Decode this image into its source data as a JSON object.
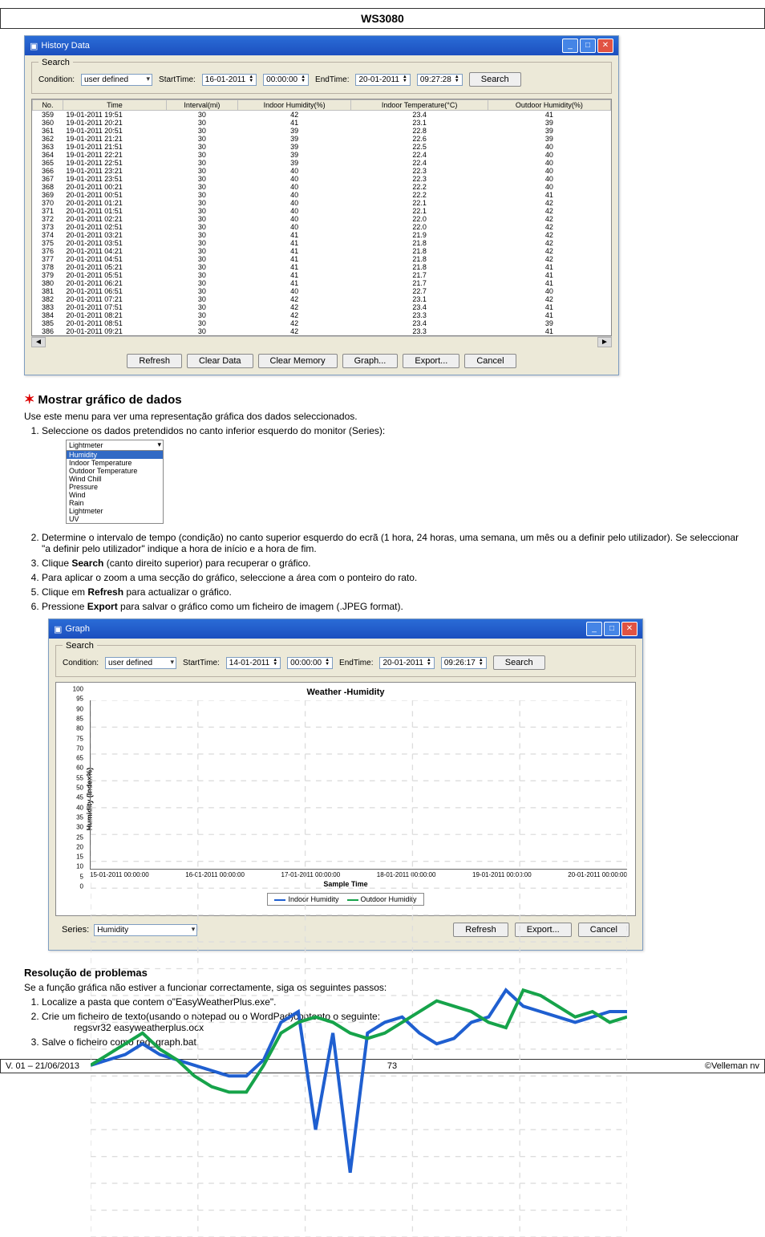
{
  "header": {
    "title": "WS3080"
  },
  "history_window": {
    "title": "History Data",
    "search": {
      "legend": "Search",
      "condition_label": "Condition:",
      "condition_value": "user defined",
      "start_label": "StartTime:",
      "start_date": "16-01-2011",
      "start_time": "00:00:00",
      "end_label": "EndTime:",
      "end_date": "20-01-2011",
      "end_time": "09:27:28",
      "search_btn": "Search"
    },
    "columns": [
      "No.",
      "Time",
      "Interval(mi)",
      "Indoor Humidity(%)",
      "Indoor Temperature(°C)",
      "Outdoor Humidity(%)"
    ],
    "rows": [
      {
        "no": "359",
        "time": "19-01-2011 19:51",
        "interval": "30",
        "ih": "42",
        "it": "23.4",
        "oh": "41"
      },
      {
        "no": "360",
        "time": "19-01-2011 20:21",
        "interval": "30",
        "ih": "41",
        "it": "23.1",
        "oh": "39"
      },
      {
        "no": "361",
        "time": "19-01-2011 20:51",
        "interval": "30",
        "ih": "39",
        "it": "22.8",
        "oh": "39"
      },
      {
        "no": "362",
        "time": "19-01-2011 21:21",
        "interval": "30",
        "ih": "39",
        "it": "22.6",
        "oh": "39"
      },
      {
        "no": "363",
        "time": "19-01-2011 21:51",
        "interval": "30",
        "ih": "39",
        "it": "22.5",
        "oh": "40"
      },
      {
        "no": "364",
        "time": "19-01-2011 22:21",
        "interval": "30",
        "ih": "39",
        "it": "22.4",
        "oh": "40"
      },
      {
        "no": "365",
        "time": "19-01-2011 22:51",
        "interval": "30",
        "ih": "39",
        "it": "22.4",
        "oh": "40"
      },
      {
        "no": "366",
        "time": "19-01-2011 23:21",
        "interval": "30",
        "ih": "40",
        "it": "22.3",
        "oh": "40"
      },
      {
        "no": "367",
        "time": "19-01-2011 23:51",
        "interval": "30",
        "ih": "40",
        "it": "22.3",
        "oh": "40"
      },
      {
        "no": "368",
        "time": "20-01-2011 00:21",
        "interval": "30",
        "ih": "40",
        "it": "22.2",
        "oh": "40"
      },
      {
        "no": "369",
        "time": "20-01-2011 00:51",
        "interval": "30",
        "ih": "40",
        "it": "22.2",
        "oh": "41"
      },
      {
        "no": "370",
        "time": "20-01-2011 01:21",
        "interval": "30",
        "ih": "40",
        "it": "22.1",
        "oh": "42"
      },
      {
        "no": "371",
        "time": "20-01-2011 01:51",
        "interval": "30",
        "ih": "40",
        "it": "22.1",
        "oh": "42"
      },
      {
        "no": "372",
        "time": "20-01-2011 02:21",
        "interval": "30",
        "ih": "40",
        "it": "22.0",
        "oh": "42"
      },
      {
        "no": "373",
        "time": "20-01-2011 02:51",
        "interval": "30",
        "ih": "40",
        "it": "22.0",
        "oh": "42"
      },
      {
        "no": "374",
        "time": "20-01-2011 03:21",
        "interval": "30",
        "ih": "41",
        "it": "21.9",
        "oh": "42"
      },
      {
        "no": "375",
        "time": "20-01-2011 03:51",
        "interval": "30",
        "ih": "41",
        "it": "21.8",
        "oh": "42"
      },
      {
        "no": "376",
        "time": "20-01-2011 04:21",
        "interval": "30",
        "ih": "41",
        "it": "21.8",
        "oh": "42"
      },
      {
        "no": "377",
        "time": "20-01-2011 04:51",
        "interval": "30",
        "ih": "41",
        "it": "21.8",
        "oh": "42"
      },
      {
        "no": "378",
        "time": "20-01-2011 05:21",
        "interval": "30",
        "ih": "41",
        "it": "21.8",
        "oh": "41"
      },
      {
        "no": "379",
        "time": "20-01-2011 05:51",
        "interval": "30",
        "ih": "41",
        "it": "21.7",
        "oh": "41"
      },
      {
        "no": "380",
        "time": "20-01-2011 06:21",
        "interval": "30",
        "ih": "41",
        "it": "21.7",
        "oh": "41"
      },
      {
        "no": "381",
        "time": "20-01-2011 06:51",
        "interval": "30",
        "ih": "40",
        "it": "22.7",
        "oh": "40"
      },
      {
        "no": "382",
        "time": "20-01-2011 07:21",
        "interval": "30",
        "ih": "42",
        "it": "23.1",
        "oh": "42"
      },
      {
        "no": "383",
        "time": "20-01-2011 07:51",
        "interval": "30",
        "ih": "42",
        "it": "23.4",
        "oh": "41"
      },
      {
        "no": "384",
        "time": "20-01-2011 08:21",
        "interval": "30",
        "ih": "42",
        "it": "23.3",
        "oh": "41"
      },
      {
        "no": "385",
        "time": "20-01-2011 08:51",
        "interval": "30",
        "ih": "42",
        "it": "23.4",
        "oh": "39"
      },
      {
        "no": "386",
        "time": "20-01-2011 09:21",
        "interval": "30",
        "ih": "42",
        "it": "23.3",
        "oh": "41"
      }
    ],
    "buttons": {
      "refresh": "Refresh",
      "clear_data": "Clear Data",
      "clear_memory": "Clear Memory",
      "graph": "Graph...",
      "export": "Export...",
      "cancel": "Cancel"
    }
  },
  "section1": {
    "heading": "Mostrar gráfico de dados",
    "intro": "Use este menu para ver uma representação gráfica dos dados seleccionados.",
    "steps": {
      "s1": "Seleccione os dados pretendidos no canto inferior esquerdo do monitor (Series):",
      "s2": "Determine o intervalo de tempo (condição) no canto superior esquerdo do ecrã (1 hora, 24 horas, uma semana, um mês ou a definir pelo utilizador). Se seleccionar \"a definir pelo utilizador\" indique a hora de início e a hora de fim.",
      "s3_a": "Clique ",
      "s3_b": "Search",
      "s3_c": " (canto direito superior) para recuperar o gráfico.",
      "s4": "Para aplicar o zoom a uma secção do gráfico, seleccione a área com o ponteiro do rato.",
      "s5_a": "Clique em ",
      "s5_b": "Refresh",
      "s5_c": " para actualizar o gráfico.",
      "s6_a": "Pressione ",
      "s6_b": "Export",
      "s6_c": " para salvar o gráfico como um ficheiro de imagem (.JPEG format)."
    }
  },
  "series_dropdown": {
    "selected": "Lightmeter",
    "highlighted": "Humidity",
    "options": [
      "Indoor Temperature",
      "Outdoor Temperature",
      "Wind Chill",
      "Pressure",
      "Wind",
      "Rain",
      "Lightmeter",
      "UV"
    ]
  },
  "graph_window": {
    "title": "Graph",
    "search": {
      "legend": "Search",
      "condition_label": "Condition:",
      "condition_value": "user defined",
      "start_label": "StartTime:",
      "start_date": "14-01-2011",
      "start_time": "00:00:00",
      "end_label": "EndTime:",
      "end_date": "20-01-2011",
      "end_time": "09:26:17",
      "search_btn": "Search"
    },
    "chart": {
      "title": "Weather -Humidity",
      "ylabel": "Humidity (Index%)",
      "xlabel": "Sample Time",
      "xticks": [
        "15-01-2011 00:00:00",
        "16-01-2011 00:00:00",
        "17-01-2011 00:00:00",
        "18-01-2011 00:00:00",
        "19-01-2011 00:00:00",
        "20-01-2011 00:00:00"
      ],
      "legend": {
        "indoor": "Indoor Humidity",
        "outdoor": "Outdoor Humidity"
      }
    },
    "bottom": {
      "series_label": "Series:",
      "series_value": "Humidity",
      "refresh": "Refresh",
      "export": "Export...",
      "cancel": "Cancel"
    }
  },
  "chart_data": {
    "type": "line",
    "title": "Weather -Humidity",
    "xlabel": "Sample Time",
    "ylabel": "Humidity (Index%)",
    "ylim": [
      0,
      100
    ],
    "x_categories": [
      "15-01-2011",
      "16-01-2011",
      "17-01-2011",
      "18-01-2011",
      "19-01-2011",
      "20-01-2011"
    ],
    "series": [
      {
        "name": "Indoor Humidity",
        "color": "#1f5fd0",
        "values": [
          32,
          33,
          34,
          36,
          34,
          33,
          32,
          31,
          30,
          30,
          33,
          40,
          42,
          20,
          38,
          12,
          38,
          40,
          41,
          38,
          36,
          37,
          40,
          41,
          46,
          43,
          42,
          41,
          40,
          41,
          42,
          42
        ]
      },
      {
        "name": "Outdoor Humidity",
        "color": "#16a34a",
        "values": [
          32,
          34,
          36,
          38,
          35,
          33,
          30,
          28,
          27,
          27,
          32,
          38,
          40,
          41,
          40,
          38,
          37,
          38,
          40,
          42,
          44,
          43,
          42,
          40,
          39,
          46,
          45,
          43,
          41,
          42,
          40,
          41
        ]
      }
    ]
  },
  "trouble": {
    "heading": "Resolução de problemas",
    "intro": "Se a função gráfica não estiver a funcionar correctamente, siga os seguintes passos:",
    "s1": "Localize a pasta que contem o\"EasyWeatherPlus.exe\".",
    "s2": "Crie um ficheiro de texto(usando o notepad ou o WordPad)contento o seguinte:",
    "s2_sub": "regsvr32 easyweatherplus.ocx",
    "s3": "Salve o ficheiro como reg_graph.bat."
  },
  "footer": {
    "left": "V. 01 – 21/06/2013",
    "center": "73",
    "right": "©Velleman nv"
  }
}
